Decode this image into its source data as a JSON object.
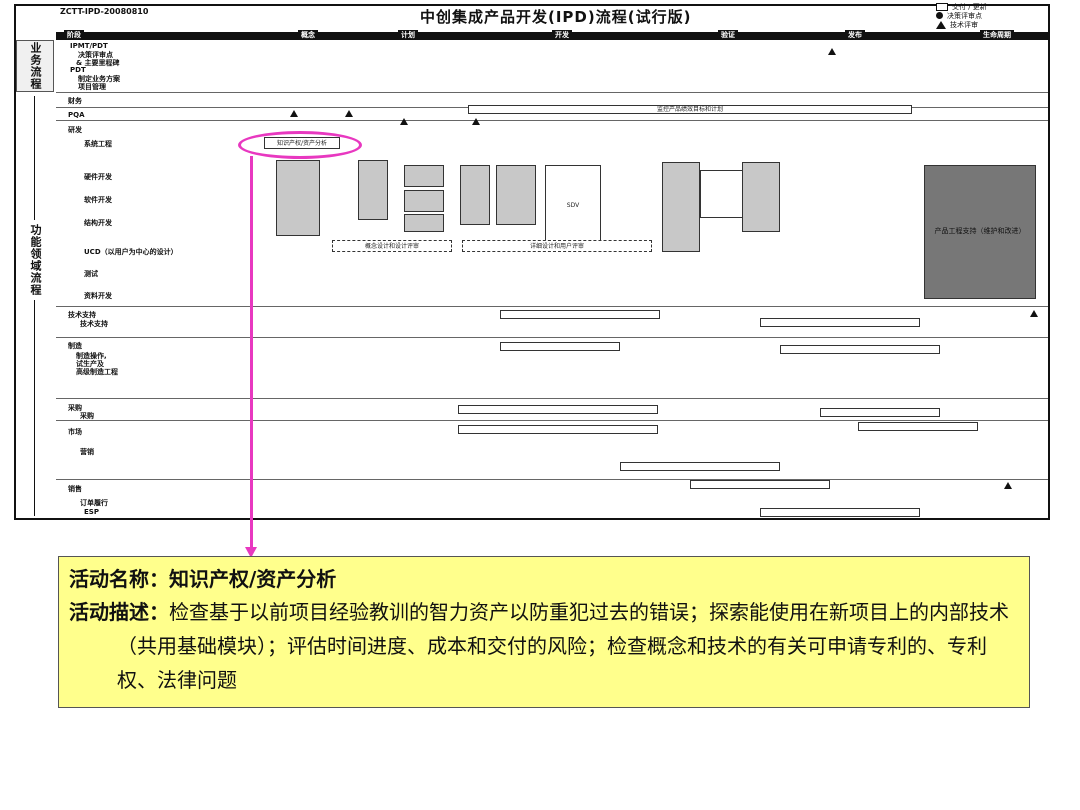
{
  "header": {
    "doc_id": "ZCTT-IPD-20080810",
    "title": "中创集成产品开发(IPD)流程(试行版)",
    "legend": [
      "交付 / 更新",
      "决策评审点",
      "技术评审"
    ]
  },
  "phases": [
    "阶段",
    "概念",
    "计划",
    "开发",
    "验证",
    "发布",
    "生命周期"
  ],
  "side_labels": {
    "business": "业务流程",
    "functional": "功能领域流程"
  },
  "rows": [
    {
      "label": "IPMT/PDT"
    },
    {
      "label": "决策评审点"
    },
    {
      "label": "& 主要里程碑"
    },
    {
      "label": "PDT"
    },
    {
      "label": "制定业务方案"
    },
    {
      "label": "项目管理"
    },
    {
      "label": "财务"
    },
    {
      "label": "PQA"
    },
    {
      "label": "研发"
    },
    {
      "label": "系统工程"
    },
    {
      "label": "硬件开发"
    },
    {
      "label": "软件开发"
    },
    {
      "label": "结构开发"
    },
    {
      "label": "UCD（以用户为中心的设计）"
    },
    {
      "label": "测试"
    },
    {
      "label": "资料开发"
    },
    {
      "label": "技术支持"
    },
    {
      "label": "技术支持"
    },
    {
      "label": "制造"
    },
    {
      "label": "制造操作,"
    },
    {
      "label": "试生产及"
    },
    {
      "label": "高级制造工程"
    },
    {
      "label": "采购"
    },
    {
      "label": "采购"
    },
    {
      "label": "市场"
    },
    {
      "label": "营销"
    },
    {
      "label": "销售"
    },
    {
      "label": "订单履行"
    },
    {
      "label": "ESP"
    }
  ],
  "diagram_boxes": {
    "overall_target": "监控产品绩效目标和计划",
    "knowledge_box": "知识产权/资产分析",
    "sdv": "SDV",
    "product_engineering": "产品工程支持（维护和改进）",
    "ucd_box": "概念设计和设计评审",
    "ucd_box2": "详细设计和用户评审"
  },
  "callout": {
    "name_label": "活动名称：",
    "name_value": "知识产权/资产分析",
    "desc_label": "活动描述：",
    "desc_value": "检查基于以前项目经验教训的智力资产以防重犯过去的错误；探索能使用在新项目上的内部技术（共用基础模块）；评估时间进度、成本和交付的风险；检查概念和技术的有关可申请专利的、专利权、法律问题"
  },
  "colors": {
    "highlight": "#e838c0",
    "callout_bg": "#ffff8c"
  }
}
